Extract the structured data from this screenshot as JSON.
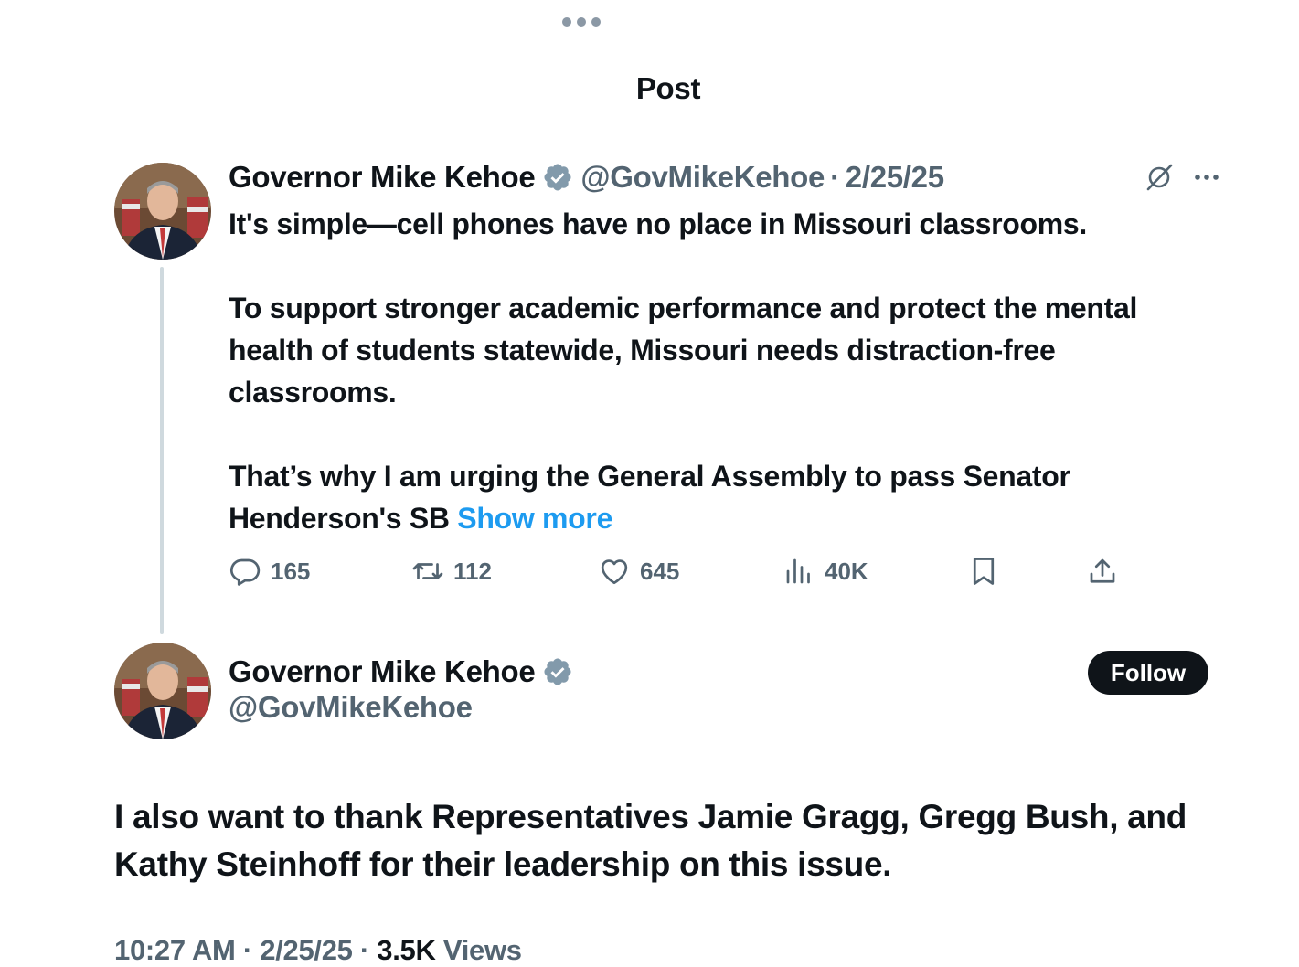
{
  "header": {
    "title": "Post"
  },
  "parent_tweet": {
    "author_name": "Governor Mike Kehoe",
    "handle": "@GovMikeKehoe",
    "separator": "·",
    "date": "2/25/25",
    "paragraphs": [
      "It's simple—cell phones have no place in Missouri classrooms.",
      "To support stronger academic performance and protect the mental health of students statewide, Missouri needs distraction-free classrooms.",
      "That’s why I am urging the General Assembly to pass Senator Henderson's SB"
    ],
    "show_more": "Show more",
    "actions": {
      "replies": "165",
      "reposts": "112",
      "likes": "645",
      "views": "40K"
    }
  },
  "main_tweet": {
    "author_name": "Governor Mike Kehoe",
    "handle": "@GovMikeKehoe",
    "follow_label": "Follow",
    "text": "I also want to thank Representatives Jamie Gragg, Gregg Bush, and Kathy Steinhoff for their leadership on this issue.",
    "time": "10:27 AM",
    "date": "2/25/25",
    "views_count": "3.5K",
    "views_label": "Views",
    "separator": "·"
  },
  "colors": {
    "text_primary": "#0f1419",
    "text_secondary": "#536471",
    "link": "#1d9bf0",
    "verified_badge": "#829aab",
    "thread_line": "#cfd9de"
  },
  "icons": [
    "grabber-dots",
    "verified-badge-icon",
    "grok-icon",
    "more-options-icon",
    "reply-icon",
    "repost-icon",
    "like-icon",
    "views-icon",
    "bookmark-icon",
    "share-icon"
  ]
}
